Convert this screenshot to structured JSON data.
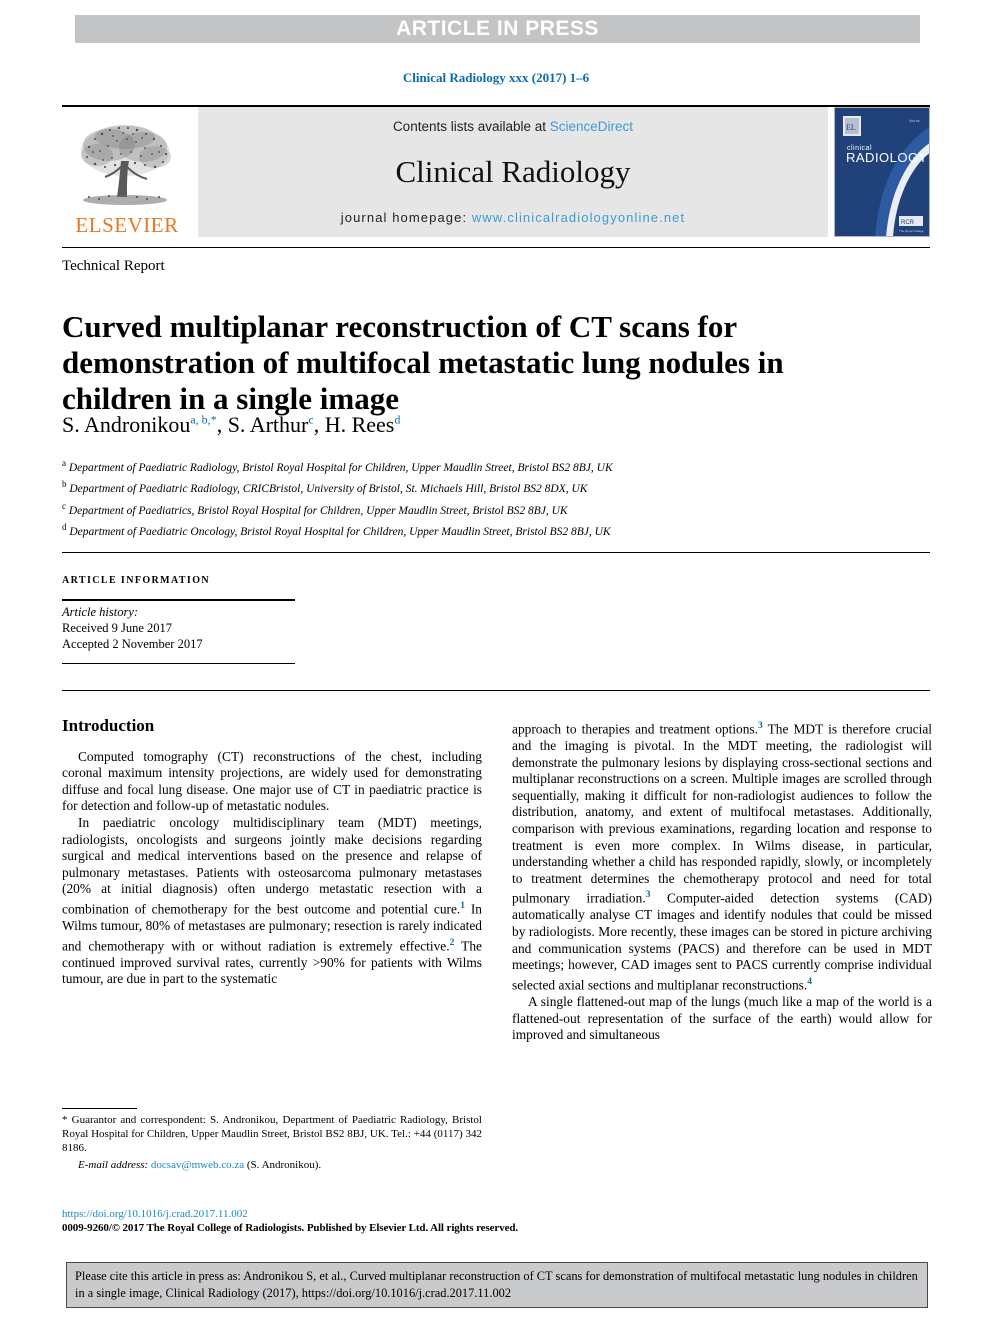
{
  "banner": {
    "label": "ARTICLE IN PRESS"
  },
  "header": {
    "citation_line": "Clinical Radiology xxx (2017) 1–6",
    "contents_prefix": "Contents lists available at ",
    "contents_link": "ScienceDirect",
    "journal_title": "Clinical Radiology",
    "homepage_prefix": "journal homepage: ",
    "homepage_link": "www.clinicalradiologyonline.net",
    "publisher_name": "ELSEVIER",
    "cover_line1": "clinical",
    "cover_line2": "RADIOLOGY"
  },
  "article": {
    "doctype": "Technical Report",
    "title": "Curved multiplanar reconstruction of CT scans for demonstration of multifocal metastatic lung nodules in children in a single image",
    "authors": [
      {
        "name": "S. Andronikou",
        "marks": "a, b,",
        "star": "*"
      },
      {
        "name": "S. Arthur",
        "marks": "c"
      },
      {
        "name": "H. Rees",
        "marks": "d"
      }
    ],
    "affiliations": [
      {
        "mark": "a",
        "text": "Department of Paediatric Radiology, Bristol Royal Hospital for Children, Upper Maudlin Street, Bristol BS2 8BJ, UK"
      },
      {
        "mark": "b",
        "text": "Department of Paediatric Radiology, CRICBristol, University of Bristol, St. Michaels Hill, Bristol BS2 8DX, UK"
      },
      {
        "mark": "c",
        "text": "Department of Paediatrics, Bristol Royal Hospital for Children, Upper Maudlin Street, Bristol BS2 8BJ, UK"
      },
      {
        "mark": "d",
        "text": "Department of Paediatric Oncology, Bristol Royal Hospital for Children, Upper Maudlin Street, Bristol BS2 8BJ, UK"
      }
    ]
  },
  "article_info": {
    "heading": "ARTICLE INFORMATION",
    "history_label": "Article history:",
    "received": "Received 9 June 2017",
    "accepted": "Accepted 2 November 2017"
  },
  "body": {
    "section_heading": "Introduction",
    "left_p1": "Computed tomography (CT) reconstructions of the chest, including coronal maximum intensity projections, are widely used for demonstrating diffuse and focal lung disease. One major use of CT in paediatric practice is for detection and follow-up of metastatic nodules.",
    "left_p2_a": "In paediatric oncology multidisciplinary team (MDT) meetings, radiologists, oncologists and surgeons jointly make decisions regarding surgical and medical interventions based on the presence and relapse of pulmonary metastases. Patients with osteosarcoma pulmonary metastases (20% at initial diagnosis) often undergo metastatic resection with a combination of chemotherapy for the best outcome and potential cure.",
    "left_p2_ref1": "1",
    "left_p2_b": " In Wilms tumour, 80% of metastases are pulmonary; resection is rarely indicated and chemotherapy with or without radiation is extremely effective.",
    "left_p2_ref2": "2",
    "left_p2_c": " The continued improved survival rates, currently >90% for patients with Wilms tumour, are due in part to the systematic",
    "right_p1_a": "approach to therapies and treatment options.",
    "right_p1_ref3": "3",
    "right_p1_b": " The MDT is therefore crucial and the imaging is pivotal. In the MDT meeting, the radiologist will demonstrate the pulmonary lesions by displaying cross-sectional sections and multiplanar reconstructions on a screen. Multiple images are scrolled through sequentially, making it difficult for non-radiologist audiences to follow the distribution, anatomy, and extent of multifocal metastases. Additionally, comparison with previous examinations, regarding location and response to treatment is even more complex. In Wilms disease, in particular, understanding whether a child has responded rapidly, slowly, or incompletely to treatment determines the chemotherapy protocol and need for total pulmonary irradiation.",
    "right_p1_ref3b": "3",
    "right_p1_c": " Computer-aided detection systems (CAD) automatically analyse CT images and identify nodules that could be missed by radiologists. More recently, these images can be stored in picture archiving and communication systems (PACS) and therefore can be used in MDT meetings; however, CAD images sent to PACS currently comprise individual selected axial sections and multiplanar reconstructions.",
    "right_p1_ref4": "4",
    "right_p2": "A single flattened-out map of the lungs (much like a map of the world is a flattened-out representation of the surface of the earth) would allow for improved and simultaneous"
  },
  "footnote": {
    "star": "*",
    "text": " Guarantor and correspondent: S. Andronikou, Department of Paediatric Radiology, Bristol Royal Hospital for Children, Upper Maudlin Street, Bristol BS2 8BJ, UK. Tel.: +44 (0117) 342 8186.",
    "email_label": "E-mail address:",
    "email": "docsav@mweb.co.za",
    "email_suffix": " (S. Andronikou)."
  },
  "doi_block": {
    "doi_url": "https://doi.org/10.1016/j.crad.2017.11.002",
    "copyright": "0009-9260/© 2017 The Royal College of Radiologists. Published by Elsevier Ltd. All rights reserved."
  },
  "cite_box": {
    "text": "Please cite this article in press as: Andronikou S, et al., Curved multiplanar reconstruction of CT scans for demonstration of multifocal metastatic lung nodules in children in a single image, Clinical Radiology (2017), https://doi.org/10.1016/j.crad.2017.11.002"
  },
  "colors": {
    "link_blue": "#1a86c8",
    "cite_blue": "#0d6ba8",
    "elsevier_orange": "#e87722",
    "banner_grey": "#c2c4c6",
    "masthead_grey": "#e6e6e6",
    "cover_navy": "#1d3f77"
  }
}
